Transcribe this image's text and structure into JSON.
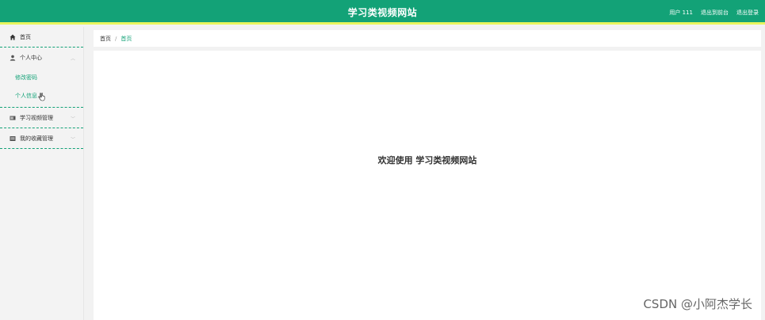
{
  "header": {
    "site_title": "学习类视频网站",
    "user_label": "用户 111",
    "back_to_home": "退出到前台",
    "logout": "退出登录"
  },
  "sidebar": {
    "items": [
      {
        "label": "首页",
        "icon": "home-icon"
      },
      {
        "label": "个人中心",
        "icon": "user-icon",
        "expanded": true,
        "children": [
          {
            "label": "修改密码"
          },
          {
            "label": "个人信息"
          }
        ]
      },
      {
        "label": "学习视频管理",
        "icon": "video-icon"
      },
      {
        "label": "我的收藏管理",
        "icon": "collection-icon"
      }
    ]
  },
  "breadcrumb": {
    "home": "首页",
    "separator": "/",
    "current": "首页"
  },
  "main": {
    "welcome_text": "欢迎使用 学习类视频网站"
  },
  "watermark": "CSDN @小阿杰学长",
  "colors": {
    "brand": "#13a277",
    "accent_line": "#e8f55d",
    "background": "#f2f2f2"
  }
}
